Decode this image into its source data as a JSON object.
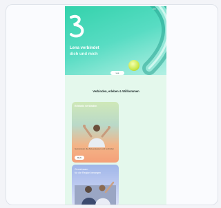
{
  "hero": {
    "title": "Lena verbindet",
    "subtitle": "dich und mich",
    "cta_label": "Los"
  },
  "section": {
    "title": "Verbinden, erleben & Willkommen"
  },
  "cards": [
    {
      "label": "Erlebnis verbinden",
      "text": "Gemeinsam die Zeit geniessen und verbinden",
      "button": "Mehr"
    },
    {
      "label_line1": "Gemeinsam",
      "label_line2": "für die Region bewegen"
    }
  ]
}
